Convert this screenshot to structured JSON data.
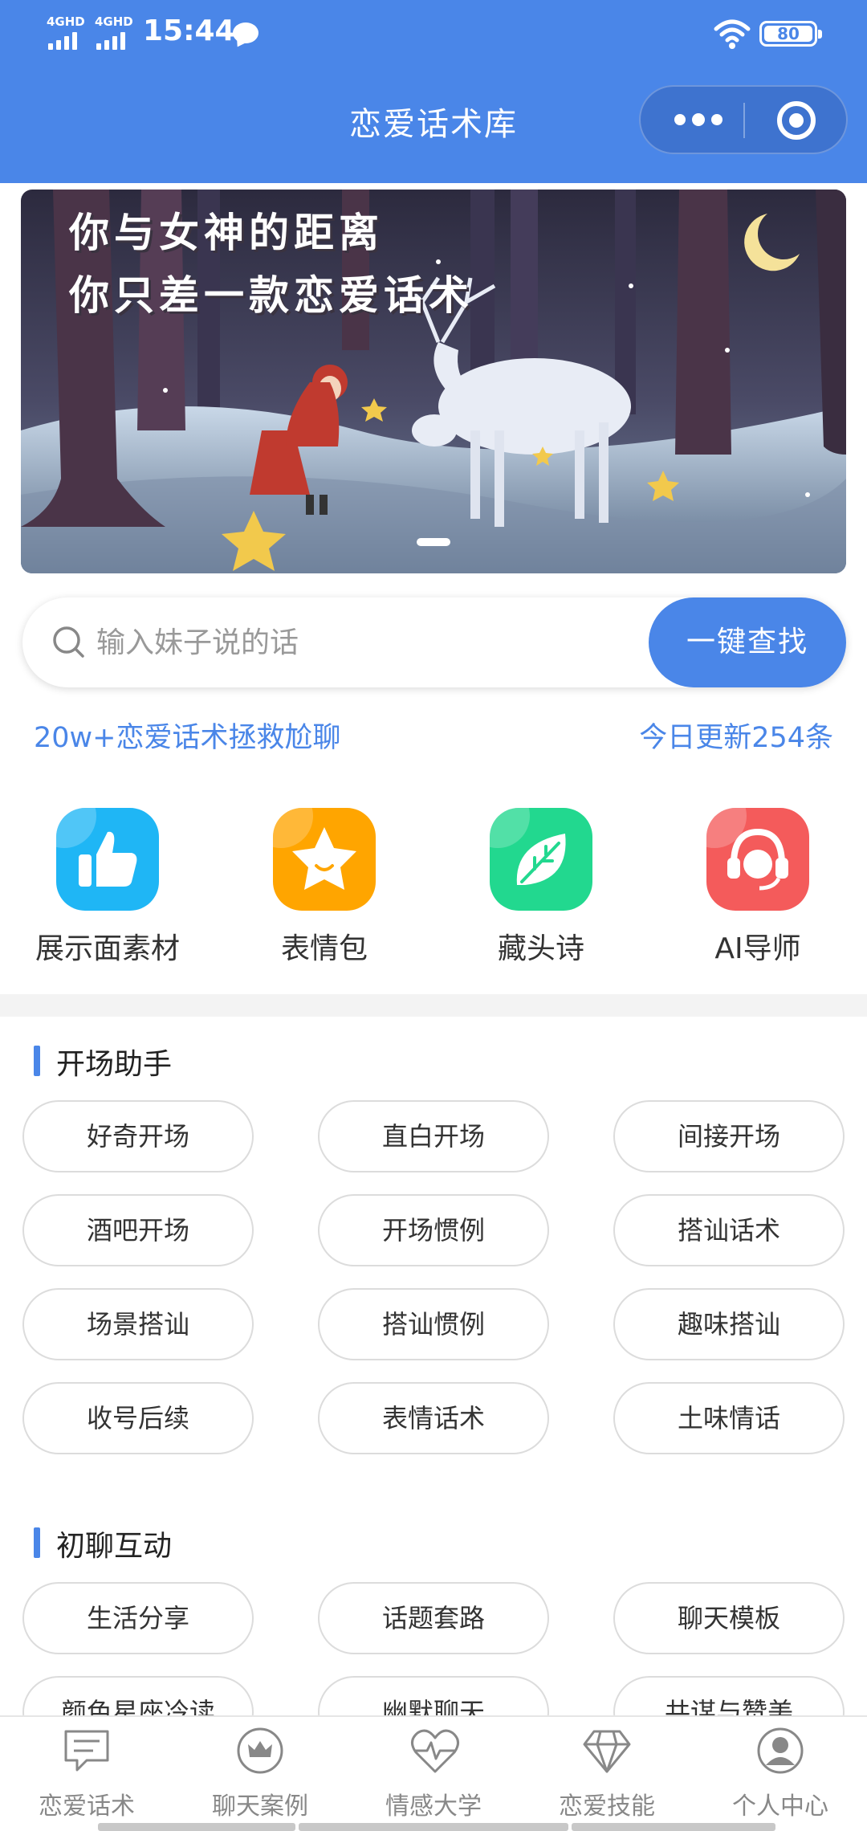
{
  "status_bar": {
    "network_1": "4GHD",
    "network_2": "4GHD",
    "time": "15:44",
    "battery": "80"
  },
  "nav": {
    "title": "恋爱话术库"
  },
  "banner": {
    "line1": "你与女神的距离",
    "line2": "你只差一款恋爱话术"
  },
  "search": {
    "placeholder": "输入妹子说的话",
    "button": "一键查找"
  },
  "stats": {
    "left": "20w+恋爱话术拯救尬聊",
    "right": "今日更新254条"
  },
  "quick_menu": [
    {
      "label": "展示面素材",
      "icon": "thumbs-up-icon",
      "color": "#1fb6f5"
    },
    {
      "label": "表情包",
      "icon": "star-icon",
      "color": "#ffa500"
    },
    {
      "label": "藏头诗",
      "icon": "leaf-icon",
      "color": "#22d88f"
    },
    {
      "label": "AI导师",
      "icon": "headset-icon",
      "color": "#f45b5b"
    }
  ],
  "sections": [
    {
      "title": "开场助手",
      "items": [
        "好奇开场",
        "直白开场",
        "间接开场",
        "酒吧开场",
        "开场惯例",
        "搭讪话术",
        "场景搭讪",
        "搭讪惯例",
        "趣味搭讪",
        "收号后续",
        "表情话术",
        "土味情话"
      ]
    },
    {
      "title": "初聊互动",
      "items": [
        "生活分享",
        "话题套路",
        "聊天模板",
        "颜色星座冷读",
        "幽默聊天",
        "共谋与赞美"
      ]
    }
  ],
  "tabbar": [
    {
      "label": "恋爱话术",
      "icon": "chat-icon"
    },
    {
      "label": "聊天案例",
      "icon": "crown-icon"
    },
    {
      "label": "情感大学",
      "icon": "heart-pulse-icon"
    },
    {
      "label": "恋爱技能",
      "icon": "diamond-icon"
    },
    {
      "label": "个人中心",
      "icon": "user-icon"
    }
  ],
  "colors": {
    "accent": "#4a86e8",
    "tab_inactive": "#888888"
  }
}
